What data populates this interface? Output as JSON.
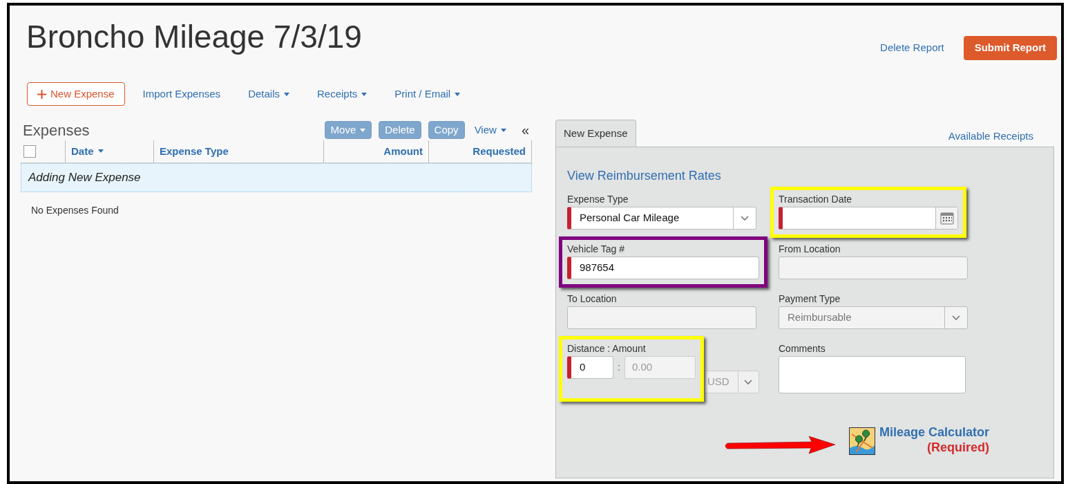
{
  "title": "Broncho Mileage 7/3/19",
  "header_actions": [
    {
      "label": "Delete Report",
      "kind": "link"
    },
    {
      "label": "Submit Report",
      "kind": "primary"
    }
  ],
  "toolbar": [
    {
      "label": "New Expense",
      "kind": "add"
    },
    {
      "label": "Import Expenses",
      "kind": "link"
    },
    {
      "label": "Details",
      "kind": "menu"
    },
    {
      "label": "Receipts",
      "kind": "menu"
    },
    {
      "label": "Print / Email",
      "kind": "menu"
    }
  ],
  "expenses": {
    "heading": "Expenses",
    "actions": [
      {
        "label": "Move",
        "kind": "menu",
        "disabled": true
      },
      {
        "label": "Delete",
        "kind": "button",
        "disabled": true
      },
      {
        "label": "Copy",
        "kind": "button",
        "disabled": true
      },
      {
        "label": "View",
        "kind": "menu",
        "disabled": false
      }
    ],
    "collapse": "«",
    "select_all": {
      "checked": false
    },
    "columns": [
      {
        "label": "Date",
        "sorted": true
      },
      {
        "label": "Expense Type",
        "sorted": false
      },
      {
        "label": "Amount",
        "sorted": false
      },
      {
        "label": "Requested",
        "sorted": false
      }
    ],
    "adding_row": "Adding New Expense",
    "empty_message": "No Expenses Found"
  },
  "panel": {
    "tabs": [
      {
        "label": "New Expense",
        "selected": true
      }
    ],
    "receipts_link": "Available Receipts",
    "rates_link": "View Reimbursement Rates",
    "fields": [
      {
        "label": "Expense Type",
        "kind": "select",
        "value": "Personal Car Mileage",
        "required": true,
        "disabled": false
      },
      {
        "label": "Transaction Date",
        "kind": "date",
        "required": true,
        "disabled": false,
        "highlight": {
          "color": "#ffff00"
        }
      },
      {
        "label": "Vehicle Tag #",
        "kind": "text",
        "value": "987654",
        "required": true,
        "disabled": false,
        "highlight": {
          "color": "#800080"
        }
      },
      {
        "label": "From Location",
        "kind": "text",
        "required": false,
        "disabled": true
      },
      {
        "label": "To Location",
        "kind": "text",
        "required": false,
        "disabled": true
      },
      {
        "label": "Payment Type",
        "kind": "select",
        "value": "Reimbursable",
        "required": false,
        "disabled": true
      },
      {
        "label": "Distance : Amount",
        "kind": "distance",
        "value": "0",
        "separator": ":",
        "amount": "0.00",
        "currency": "USD",
        "required": true,
        "disabled": false,
        "highlight": {
          "color": "#ffff00"
        }
      },
      {
        "label": "Comments",
        "kind": "textarea",
        "required": false,
        "disabled": false
      }
    ],
    "mileage_calculator": {
      "label": "Mileage Calculator",
      "note": "(Required)",
      "arrow": {
        "color": "#ff0000"
      }
    }
  }
}
